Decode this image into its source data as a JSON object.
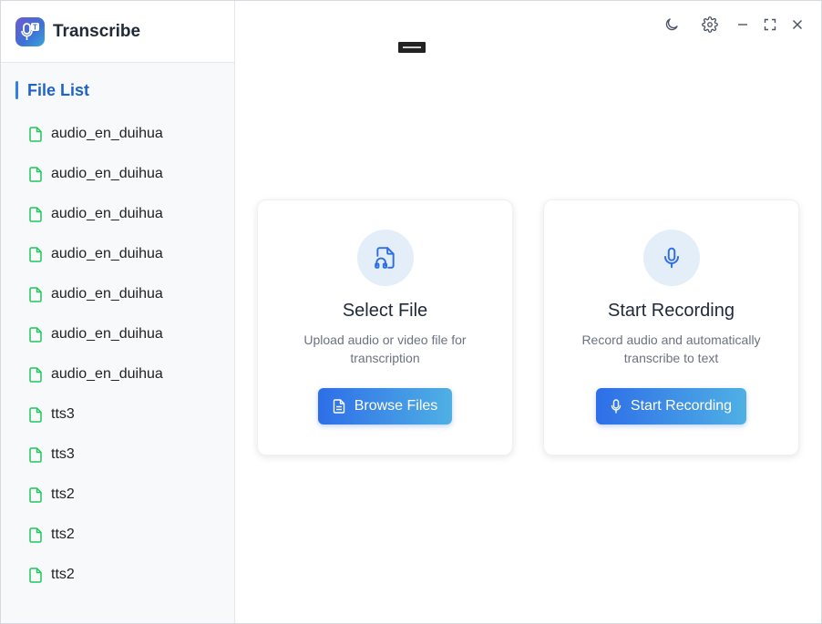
{
  "app": {
    "title": "Transcribe",
    "accent_color": "#2f80ed",
    "title_color": "#1e63c9",
    "file_icon_color": "#22c55e"
  },
  "window_controls": [
    "moon-icon",
    "gear-icon",
    "minimize-icon",
    "maximize-icon",
    "close-icon"
  ],
  "sidebar": {
    "header": "File List",
    "files": [
      "audio_en_duihua",
      "audio_en_duihua",
      "audio_en_duihua",
      "audio_en_duihua",
      "audio_en_duihua",
      "audio_en_duihua",
      "audio_en_duihua",
      "tts3",
      "tts3",
      "tts2",
      "tts2",
      "tts2"
    ]
  },
  "cards": {
    "select_file": {
      "icon": "file-audio-icon",
      "title": "Select File",
      "description": "Upload audio or video file for transcription",
      "button_label": "Browse Files",
      "button_icon": "document-icon"
    },
    "start_recording": {
      "icon": "microphone-icon",
      "title": "Start Recording",
      "description": "Record audio and automatically transcribe to text",
      "button_label": "Start Recording",
      "button_icon": "microphone-icon"
    }
  }
}
